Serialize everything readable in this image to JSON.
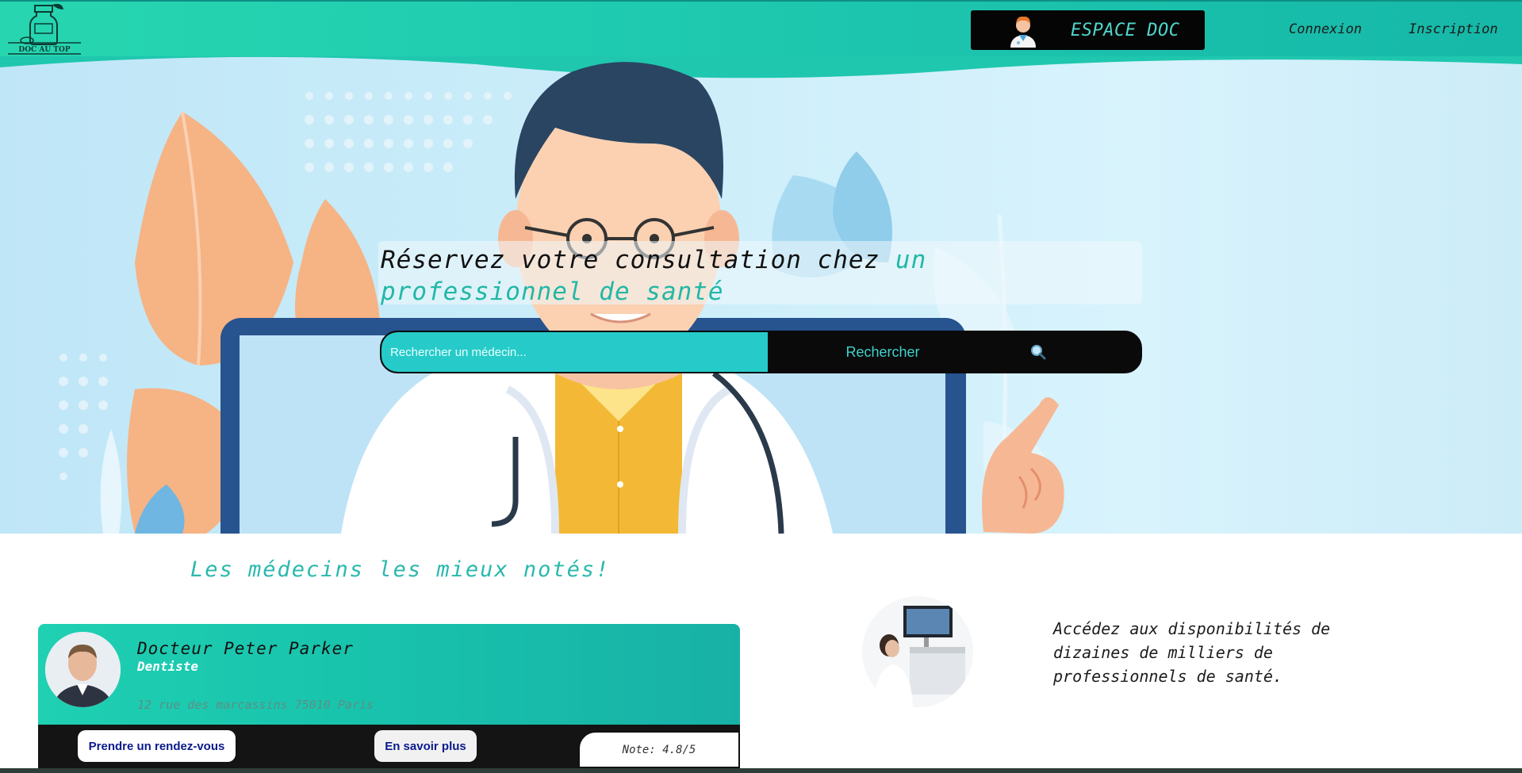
{
  "header": {
    "logo_text": "DOC AU TOP",
    "espace_doc_label": "ESPACE DOC",
    "nav": {
      "connexion": "Connexion",
      "inscription": "Inscription"
    }
  },
  "hero": {
    "headline_part1": "Réservez votre consultation chez ",
    "headline_accent": "un professionnel de santé",
    "search": {
      "placeholder": "Rechercher un médecin...",
      "button_label": "Rechercher",
      "icon": "search-icon"
    }
  },
  "top_doctors": {
    "title": "Les médecins les mieux notés!",
    "cards": [
      {
        "name": "Docteur Peter Parker",
        "specialty": "Dentiste",
        "address": "12 rue des marcassins 75010 Paris",
        "appointment_label": "Prendre un rendez-vous",
        "more_label": "En savoir plus",
        "rating_text": "Note: 4.8/5"
      }
    ]
  },
  "promo": {
    "text": "Accédez aux disponibilités de dizaines de milliers de professionnels de santé."
  },
  "colors": {
    "header_gradient_start": "#27d6b0",
    "accent_teal": "#22b8a6",
    "search_input_bg": "#26cbc9",
    "dark": "#0a0a0a"
  }
}
